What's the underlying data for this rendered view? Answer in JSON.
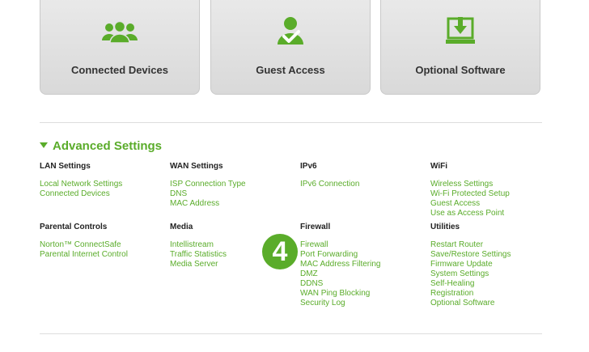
{
  "tiles": [
    {
      "label": "Connected Devices",
      "icon": "users-icon"
    },
    {
      "label": "Guest Access",
      "icon": "user-check-icon"
    },
    {
      "label": "Optional Software",
      "icon": "download-monitor-icon"
    }
  ],
  "advanced": {
    "title": "Advanced Settings"
  },
  "groups": {
    "lan": {
      "title": "LAN Settings",
      "links": [
        "Local Network Settings",
        "Connected Devices"
      ]
    },
    "wan": {
      "title": "WAN Settings",
      "links": [
        "ISP Connection Type",
        "DNS",
        "MAC Address"
      ]
    },
    "ipv6": {
      "title": "IPv6",
      "links": [
        "IPv6 Connection"
      ]
    },
    "wifi": {
      "title": "WiFi",
      "links": [
        "Wireless Settings",
        "Wi-Fi Protected Setup",
        "Guest Access",
        "Use as Access Point"
      ]
    },
    "parental": {
      "title": "Parental Controls",
      "links": [
        "Norton™ ConnectSafe",
        "Parental Internet Control"
      ]
    },
    "media": {
      "title": "Media",
      "links": [
        "Intellistream",
        "Traffic Statistics",
        "Media Server"
      ]
    },
    "firewall": {
      "title": "Firewall",
      "links": [
        "Firewall",
        "Port Forwarding",
        "MAC Address Filtering",
        "DMZ",
        "DDNS",
        "WAN Ping Blocking",
        "Security Log"
      ]
    },
    "utilities": {
      "title": "Utilities",
      "links": [
        "Restart Router",
        "Save/Restore Settings",
        "Firmware Update",
        "System Settings",
        "Self-Healing",
        "Registration",
        "Optional Software"
      ]
    }
  },
  "step_badge": "4",
  "colors": {
    "accent": "#5aac2a",
    "tile_bg": "#e2e2e2"
  }
}
